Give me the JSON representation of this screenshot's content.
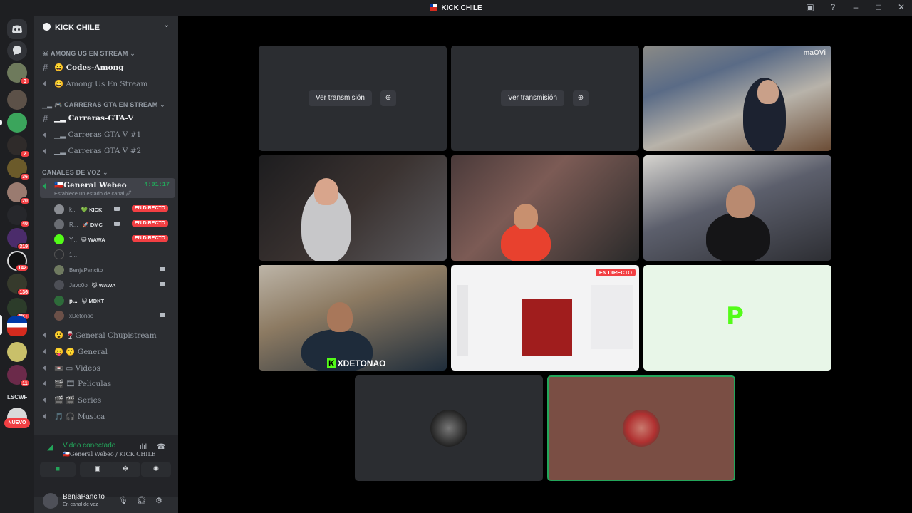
{
  "window": {
    "title": "KICK CHILE",
    "buttons": [
      "inbox-icon",
      "help-icon",
      "minimize-icon",
      "maximize-icon",
      "close-icon"
    ]
  },
  "servers": {
    "badges": [
      "3",
      "2",
      "36",
      "20",
      "40",
      "319",
      "142",
      "136",
      "1K+",
      "11"
    ],
    "new_label": "NUEVO"
  },
  "sidebar": {
    "server_name": "KICK CHILE",
    "categories": [
      {
        "label": "😀 AMONG US EN STREAM"
      },
      {
        "label": "▁▂ 🎮 CARRERAS GTA EN STREAM"
      },
      {
        "label": "CANALES DE VOZ"
      }
    ],
    "channels": [
      {
        "label": "😀 Codes-Among",
        "type": "text"
      },
      {
        "label": "😀 Among Us En Stream",
        "type": "voice"
      },
      {
        "label": "▁▂ Carreras-GTA-V",
        "type": "text"
      },
      {
        "label": "▁▂ Carreras GTA V #1",
        "type": "voice"
      },
      {
        "label": "▁▂ Carreras GTA V #2",
        "type": "voice"
      },
      {
        "label": "🇨🇱General Webeo",
        "type": "voice",
        "timer": "4:01:17",
        "status": "Establece un estado de canal 🖉"
      },
      {
        "label": "😮 🍷General Chupistream",
        "type": "voice"
      },
      {
        "label": "😛 😗 General",
        "type": "voice"
      },
      {
        "label": "📼 ▭ Videos",
        "type": "voice"
      },
      {
        "label": "🎬 🎞 Peliculas",
        "type": "voice"
      },
      {
        "label": "🎬 🎬 Series",
        "type": "voice"
      },
      {
        "label": "🎵 🎧 Musica",
        "type": "voice"
      }
    ],
    "voice_users": [
      {
        "name": "k...",
        "tag": "💚 KICK",
        "live": "EN DIRECTO",
        "cam": true
      },
      {
        "name": "R...",
        "tag": "🚀 DMC",
        "live": "EN DIRECTO",
        "cam": true
      },
      {
        "name": "Y...",
        "tag": "😺 WAWA",
        "live": "EN DIRECTO",
        "cam": false
      },
      {
        "name": "1...",
        "tag": "",
        "live": "",
        "cam": false
      },
      {
        "name": "BenjaPancito",
        "tag": "",
        "live": "",
        "cam": true
      },
      {
        "name": "Javo0o",
        "tag": "😺 WAWA",
        "live": "",
        "cam": true
      },
      {
        "name": "p...",
        "tag": "😺 MDKT",
        "live": "",
        "cam": false
      },
      {
        "name": "xDetonao",
        "tag": "",
        "live": "",
        "cam": true
      }
    ]
  },
  "voice_panel": {
    "status": "Video conectado",
    "channel": "🇨🇱General Webeo / KICK CHILE"
  },
  "user_panel": {
    "name": "BenjaPancito",
    "status": "En canal de voz"
  },
  "call": {
    "watch_label": "Ver transmisión",
    "watermark": "maOVi",
    "live_badge": "EN DIRECTO",
    "overlay_name": "XDETONAO"
  }
}
